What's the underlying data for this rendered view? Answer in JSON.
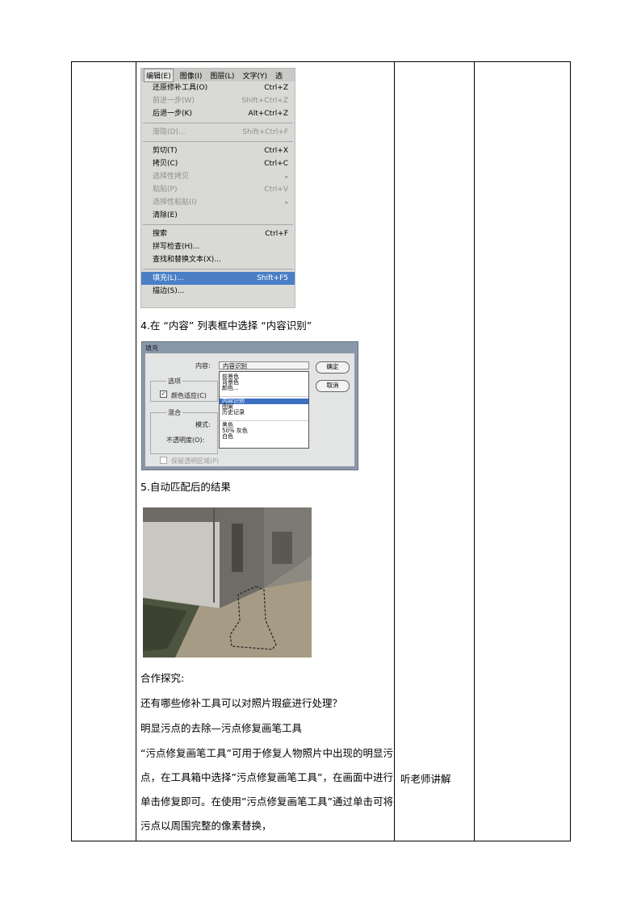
{
  "menu": {
    "bar": [
      "编辑(E)",
      "图像(I)",
      "图层(L)",
      "文字(Y)",
      "选"
    ],
    "groups": [
      [
        {
          "label": "还原修补工具(O)",
          "shortcut": "Ctrl+Z",
          "disabled": false
        },
        {
          "label": "前进一步(W)",
          "shortcut": "Shift+Ctrl+Z",
          "disabled": true
        },
        {
          "label": "后退一步(K)",
          "shortcut": "Alt+Ctrl+Z",
          "disabled": false
        }
      ],
      [
        {
          "label": "渐隐(D)...",
          "shortcut": "Shift+Ctrl+F",
          "disabled": true
        }
      ],
      [
        {
          "label": "剪切(T)",
          "shortcut": "Ctrl+X",
          "disabled": false
        },
        {
          "label": "拷贝(C)",
          "shortcut": "Ctrl+C",
          "disabled": false
        },
        {
          "label": "选择性拷贝",
          "shortcut": "",
          "disabled": true,
          "submenu": true
        },
        {
          "label": "粘贴(P)",
          "shortcut": "Ctrl+V",
          "disabled": true
        },
        {
          "label": "选择性粘贴(I)",
          "shortcut": "",
          "disabled": true,
          "submenu": true
        },
        {
          "label": "清除(E)",
          "shortcut": "",
          "disabled": false
        }
      ],
      [
        {
          "label": "搜索",
          "shortcut": "Ctrl+F",
          "disabled": false
        },
        {
          "label": "拼写检查(H)...",
          "shortcut": "",
          "disabled": false
        },
        {
          "label": "查找和替换文本(X)...",
          "shortcut": "",
          "disabled": false
        }
      ],
      [
        {
          "label": "填充(L)...",
          "shortcut": "Shift+F5",
          "disabled": false,
          "highlighted": true
        },
        {
          "label": "描边(S)...",
          "shortcut": "",
          "disabled": false
        }
      ]
    ]
  },
  "step4": "4.在 “内容” 列表框中选择 “内容识别”",
  "dialog": {
    "title": "填充",
    "content_label": "内容:",
    "content_value": "内容识别",
    "ok": "确定",
    "cancel": "取消",
    "options_label": "选项",
    "color_adapt": "颜色适应(C)",
    "blend_label": "混合",
    "mode_label": "模式:",
    "opacity_label": "不透明度(O):",
    "preserve": "保留透明区域(P)",
    "dropdown": {
      "group1": [
        "前景色",
        "背景色",
        "颜色..."
      ],
      "group2": [
        "内容识别",
        "图案",
        "历史记录"
      ],
      "group3": [
        "黑色",
        "50% 灰色",
        "白色"
      ]
    }
  },
  "step5": "5.自动匹配后的结果",
  "explore_title": "合作探究:",
  "question": "还有哪些修补工具可以对照片瑕疵进行处理？",
  "tool_line": "明显污点的去除—污点修复画笔工具",
  "paragraph": "“污点修复画笔工具”可用于修复人物照片中出现的明显污点，在工具箱中选择”污点修复画笔工具”，在画面中进行单击修复即可。在使用”污点修复画笔工具”通过单击可将污点以周围完整的像素替换，",
  "student_activity": "听老师讲解",
  "colors": {
    "highlight": "#4a7fc6",
    "border": "#000000"
  }
}
